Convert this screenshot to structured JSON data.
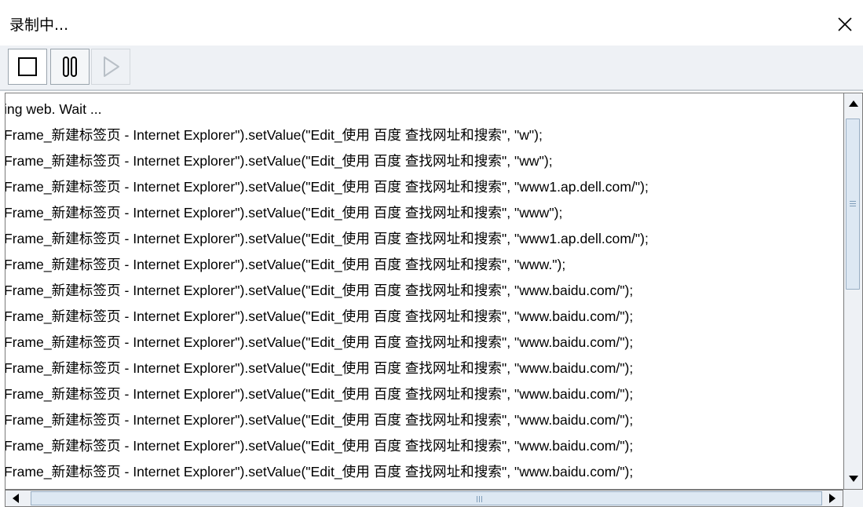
{
  "window": {
    "title": "录制中...",
    "close_icon": "close-icon"
  },
  "toolbar": {
    "buttons": [
      {
        "name": "stop",
        "icon": "stop-icon",
        "enabled": true
      },
      {
        "name": "pause",
        "icon": "pause-icon",
        "enabled": true
      },
      {
        "name": "play",
        "icon": "play-icon",
        "enabled": false
      }
    ]
  },
  "log": {
    "lines": [
      "ing web. Wait ...",
      "Frame_新建标签页 - Internet Explorer\").setValue(\"Edit_使用 百度 查找网址和搜索\", \"w\");",
      "Frame_新建标签页 - Internet Explorer\").setValue(\"Edit_使用 百度 查找网址和搜索\", \"ww\");",
      "Frame_新建标签页 - Internet Explorer\").setValue(\"Edit_使用 百度 查找网址和搜索\", \"www1.ap.dell.com/\");",
      "Frame_新建标签页 - Internet Explorer\").setValue(\"Edit_使用 百度 查找网址和搜索\", \"www\");",
      "Frame_新建标签页 - Internet Explorer\").setValue(\"Edit_使用 百度 查找网址和搜索\", \"www1.ap.dell.com/\");",
      "Frame_新建标签页 - Internet Explorer\").setValue(\"Edit_使用 百度 查找网址和搜索\", \"www.\");",
      "Frame_新建标签页 - Internet Explorer\").setValue(\"Edit_使用 百度 查找网址和搜索\", \"www.baidu.com/\");",
      "Frame_新建标签页 - Internet Explorer\").setValue(\"Edit_使用 百度 查找网址和搜索\", \"www.baidu.com/\");",
      "Frame_新建标签页 - Internet Explorer\").setValue(\"Edit_使用 百度 查找网址和搜索\", \"www.baidu.com/\");",
      "Frame_新建标签页 - Internet Explorer\").setValue(\"Edit_使用 百度 查找网址和搜索\", \"www.baidu.com/\");",
      "Frame_新建标签页 - Internet Explorer\").setValue(\"Edit_使用 百度 查找网址和搜索\", \"www.baidu.com/\");",
      "Frame_新建标签页 - Internet Explorer\").setValue(\"Edit_使用 百度 查找网址和搜索\", \"www.baidu.com/\");",
      "Frame_新建标签页 - Internet Explorer\").setValue(\"Edit_使用 百度 查找网址和搜索\", \"www.baidu.com/\");",
      "Frame_新建标签页 - Internet Explorer\").setValue(\"Edit_使用 百度 查找网址和搜索\", \"www.baidu.com/\");"
    ]
  },
  "colors": {
    "toolbar_bg": "#eef1f5",
    "scroll_thumb": "#dde8f3",
    "border": "#7b7b7b"
  }
}
